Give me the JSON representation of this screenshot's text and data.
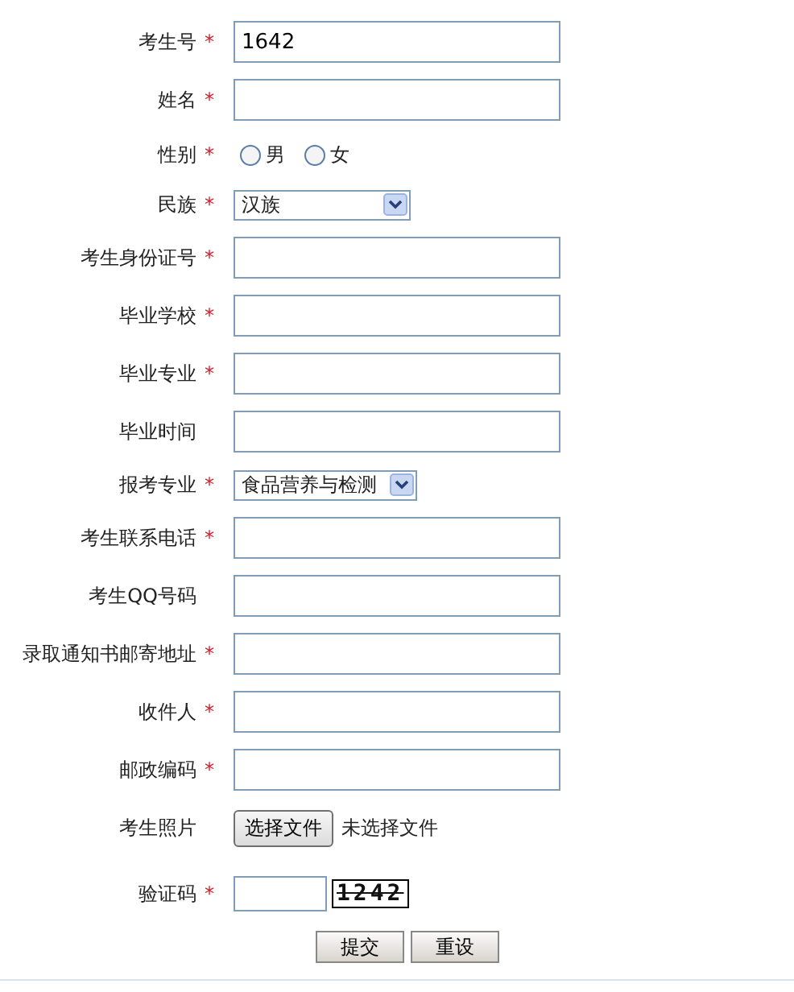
{
  "fields": [
    {
      "kind": "text",
      "label": "考生号",
      "required": true,
      "value": "1642"
    },
    {
      "kind": "text",
      "label": "姓名",
      "required": true
    },
    {
      "kind": "radio",
      "label": "性别",
      "required": true,
      "options": [
        {
          "label": "男",
          "selected": false
        },
        {
          "label": "女",
          "selected": false
        }
      ]
    },
    {
      "kind": "select",
      "label": "民族",
      "required": true,
      "value": "汉族"
    },
    {
      "kind": "text",
      "label": "考生身份证号",
      "required": true
    },
    {
      "kind": "text",
      "label": "毕业学校",
      "required": true
    },
    {
      "kind": "text",
      "label": "毕业专业",
      "required": true
    },
    {
      "kind": "text",
      "label": "毕业时间",
      "required": false
    },
    {
      "kind": "select",
      "label": "报考专业",
      "required": true,
      "value": "食品营养与检测"
    },
    {
      "kind": "text",
      "label": "考生联系电话",
      "required": true
    },
    {
      "kind": "text",
      "label": "考生QQ号码",
      "required": false
    },
    {
      "kind": "text",
      "label": "录取通知书邮寄地址",
      "required": true
    },
    {
      "kind": "text",
      "label": "收件人",
      "required": true
    },
    {
      "kind": "text",
      "label": "邮政编码",
      "required": true
    },
    {
      "kind": "file",
      "label": "考生照片",
      "required": false,
      "button": "选择文件",
      "status": "未选择文件"
    },
    {
      "kind": "captcha",
      "label": "验证码",
      "required": true,
      "code": "1242"
    }
  ],
  "required_mark": "*",
  "buttons": [
    "提交",
    "重设"
  ]
}
